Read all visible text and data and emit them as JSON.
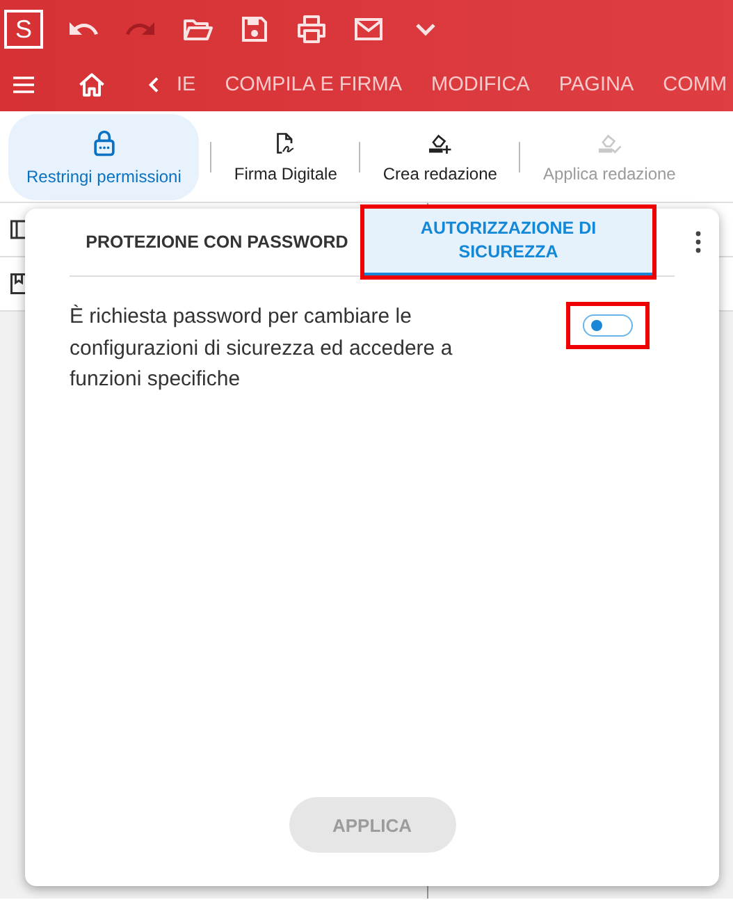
{
  "app_logo": "S",
  "quick_toolbar": [
    {
      "kind": "undo",
      "disabled": false
    },
    {
      "kind": "redo",
      "disabled": true
    },
    {
      "kind": "open"
    },
    {
      "kind": "save"
    },
    {
      "kind": "print"
    },
    {
      "kind": "mail"
    },
    {
      "kind": "more"
    }
  ],
  "nav_tabs": [
    "IE",
    "COMPILA E FIRMA",
    "MODIFICA",
    "PAGINA",
    "COMM"
  ],
  "ribbon": [
    {
      "kind": "lock",
      "label": "Restringi permissioni",
      "selected": true,
      "disabled": false
    },
    {
      "kind": "sign",
      "label": "Firma Digitale",
      "selected": false,
      "disabled": false
    },
    {
      "kind": "redact",
      "label": "Crea redazione",
      "selected": false,
      "disabled": false
    },
    {
      "kind": "apply",
      "label": "Applica redazione",
      "selected": false,
      "disabled": true
    }
  ],
  "panel": {
    "tabs": [
      {
        "label": "PROTEZIONE CON PASSWORD",
        "selected": false,
        "highlighted": false
      },
      {
        "label": "AUTORIZZAZIONE DI SICUREZZA",
        "selected": true,
        "highlighted": true
      }
    ],
    "setting": {
      "text": "È richiesta password per cambiare le configurazioni di sicurezza ed accedere a funzioni specifiche",
      "on": false,
      "highlighted": true
    },
    "apply_button": {
      "label": "APPLICA",
      "disabled": true
    }
  }
}
